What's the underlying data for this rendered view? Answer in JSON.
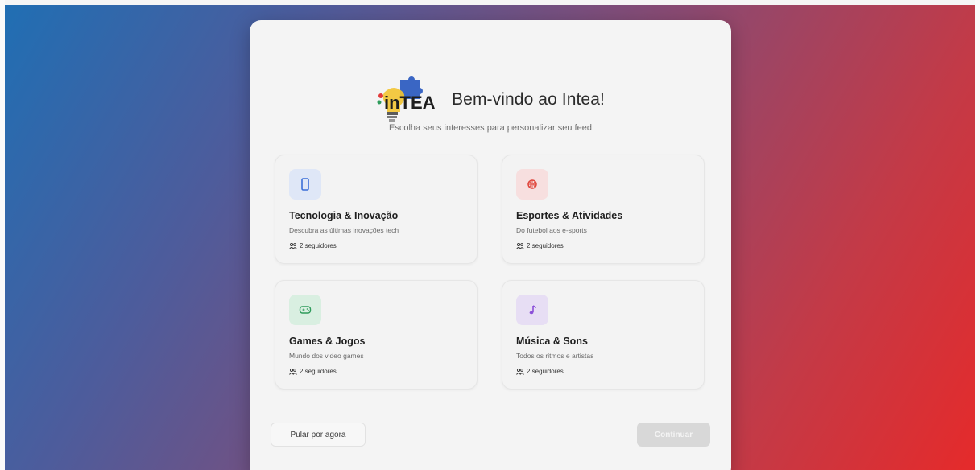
{
  "header": {
    "title": "Bem-vindo ao Intea!",
    "logo_text": "inTEA",
    "subtitle": "Escolha seus interesses para personalizar seu feed"
  },
  "interests": [
    {
      "name": "Tecnologia & Inovação",
      "description": "Descubra as últimas inovações tech",
      "followers": "2 seguidores",
      "icon": "smartphone-icon",
      "icon_bg": "#dfe7f7",
      "icon_color": "#3b6fd8"
    },
    {
      "name": "Esportes & Atividades",
      "description": "Do futebol aos e-sports",
      "followers": "2 seguidores",
      "icon": "basketball-icon",
      "icon_bg": "#f7dfdf",
      "icon_color": "#e0473d"
    },
    {
      "name": "Games & Jogos",
      "description": "Mundo dos video games",
      "followers": "2 seguidores",
      "icon": "gamepad-icon",
      "icon_bg": "#d9efe1",
      "icon_color": "#2f9c5b"
    },
    {
      "name": "Música & Sons",
      "description": "Todos os ritmos e artistas",
      "followers": "2 seguidores",
      "icon": "music-note-icon",
      "icon_bg": "#e7def4",
      "icon_color": "#8b4fd8"
    }
  ],
  "actions": {
    "skip_label": "Pular por agora",
    "continue_label": "Continuar"
  }
}
